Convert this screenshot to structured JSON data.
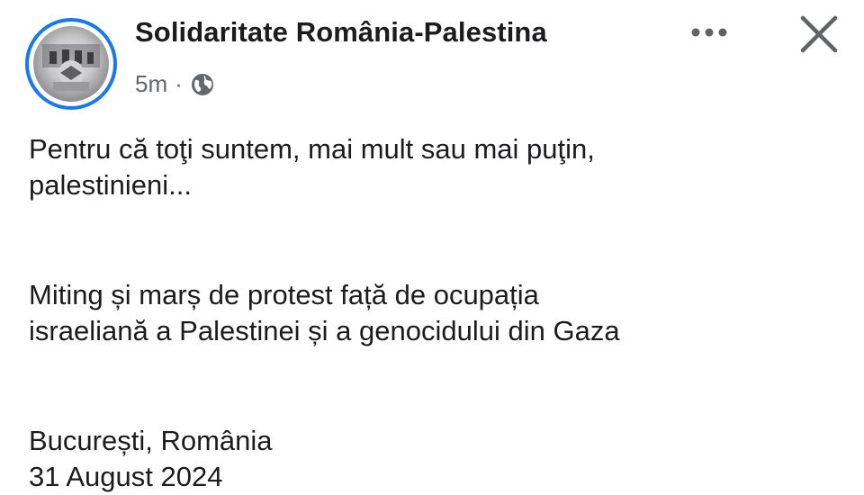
{
  "post": {
    "group_name": "Solidaritate România-Palestina",
    "timestamp": "5m",
    "separator": "·",
    "privacy_icon": "globe-icon",
    "more_icon": "more-options-icon",
    "close_icon": "close-icon",
    "paragraphs": [
      [
        "Pentru că toţi suntem, mai mult sau mai puţin,",
        "palestinieni..."
      ],
      [
        "Miting și marș de protest față de ocupația",
        "israeliană a Palestinei și a genocidului din Gaza"
      ],
      [
        "București, România",
        "31 August 2024"
      ]
    ]
  },
  "colors": {
    "avatar_ring": "#1877f2",
    "text_primary": "#1c1c1e",
    "text_secondary": "#65676b",
    "icon_gray": "#606266"
  }
}
